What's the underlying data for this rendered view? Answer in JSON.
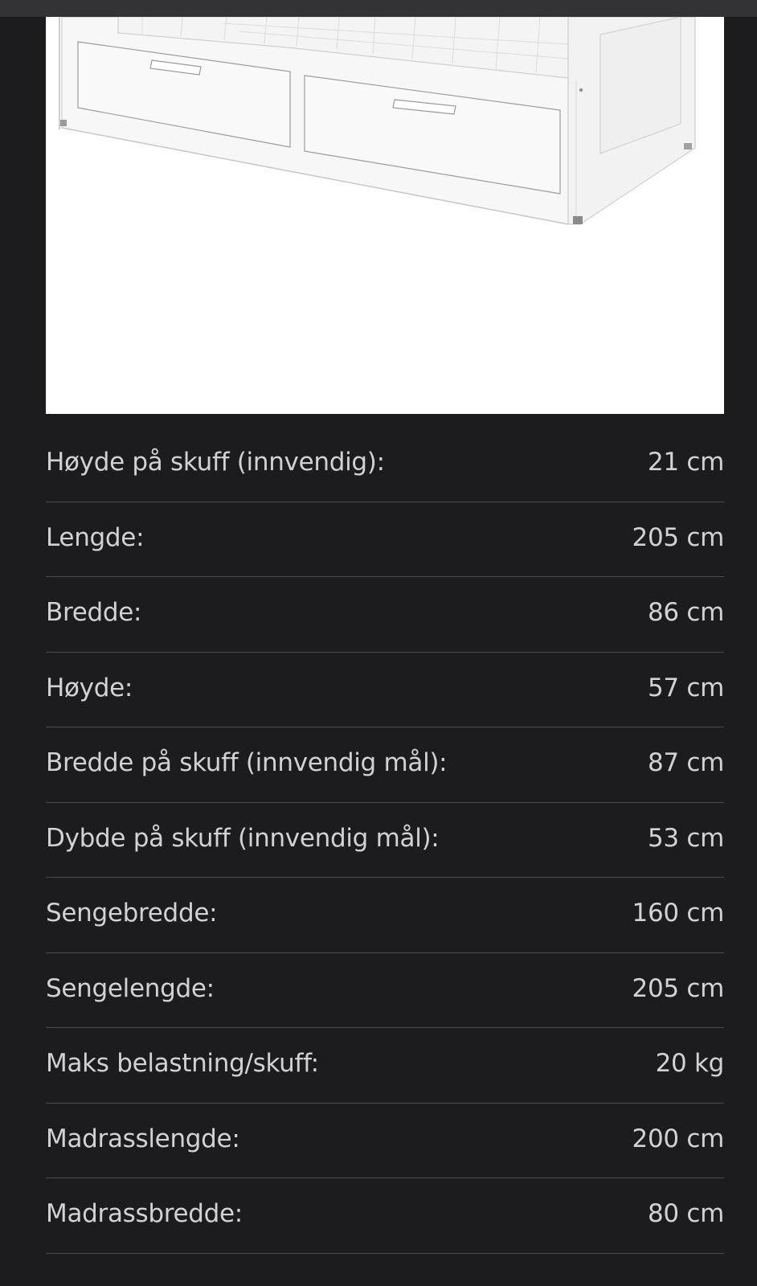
{
  "colors": {
    "background": "#1c1c1e",
    "top_bar": "#333335",
    "text": "#d2d2d4",
    "divider": "#4a4a4c",
    "image_background": "#ffffff"
  },
  "product_image": {
    "subject": "white daybed frame with two drawers"
  },
  "specs": [
    {
      "label": "Høyde på skuff (innvendig):",
      "value": "21 cm"
    },
    {
      "label": "Lengde:",
      "value": "205 cm"
    },
    {
      "label": "Bredde:",
      "value": "86 cm"
    },
    {
      "label": "Høyde:",
      "value": "57 cm"
    },
    {
      "label": "Bredde på skuff (innvendig mål):",
      "value": "87 cm"
    },
    {
      "label": "Dybde på skuff (innvendig mål):",
      "value": "53 cm"
    },
    {
      "label": "Sengebredde:",
      "value": "160 cm"
    },
    {
      "label": "Sengelengde:",
      "value": "205 cm"
    },
    {
      "label": "Maks belastning/skuff:",
      "value": "20 kg"
    },
    {
      "label": "Madrasslengde:",
      "value": "200 cm"
    },
    {
      "label": "Madrassbredde:",
      "value": "80 cm"
    }
  ]
}
